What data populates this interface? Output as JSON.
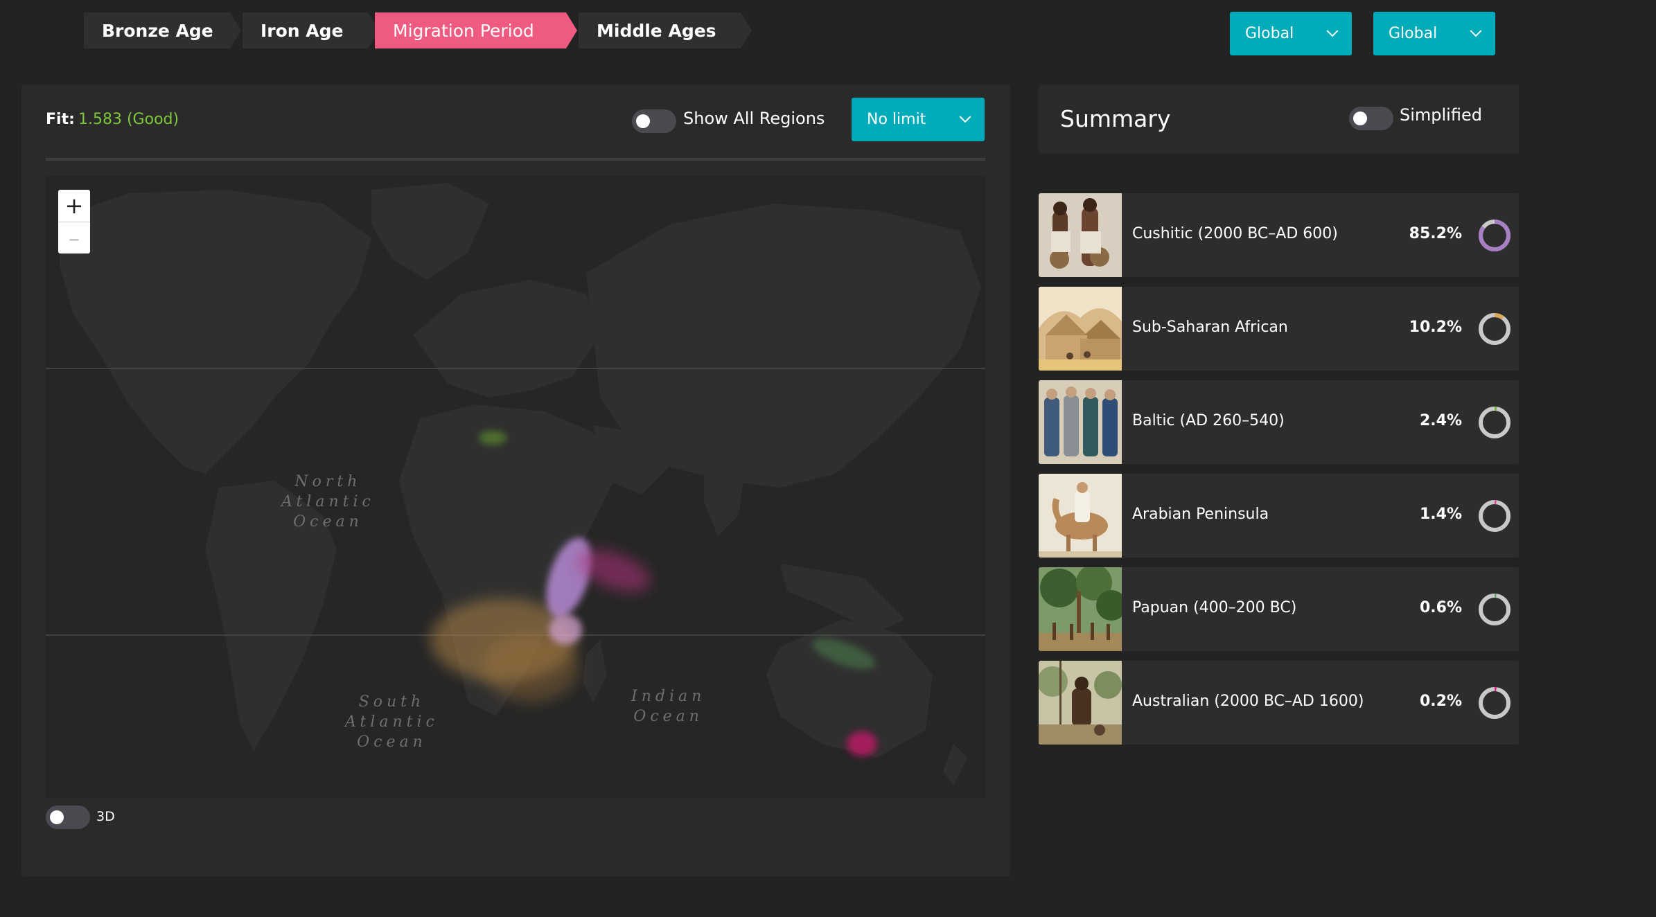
{
  "era_tabs": [
    {
      "label": "Bronze Age",
      "active": false
    },
    {
      "label": "Iron Age",
      "active": false
    },
    {
      "label": "Migration Period",
      "active": true
    },
    {
      "label": "Middle Ages",
      "active": false
    }
  ],
  "dropdowns": {
    "left": "Global",
    "right": "Global"
  },
  "map_panel": {
    "fit_label": "Fit:",
    "fit_value": "1.583 (Good)",
    "show_all_regions_label": "Show All Regions",
    "show_all_regions_on": false,
    "limit_selected": "No limit",
    "zoom_in": "+",
    "zoom_out": "–",
    "toggle_3d_label": "3D",
    "toggle_3d_on": false,
    "ocean_labels": {
      "north_atlantic": [
        "North",
        "Atlantic",
        "Ocean"
      ],
      "south_atlantic": [
        "South",
        "Atlantic",
        "Ocean"
      ],
      "indian": [
        "Indian",
        "Ocean"
      ]
    }
  },
  "summary": {
    "title": "Summary",
    "simplified_label": "Simplified",
    "simplified_on": false,
    "items": [
      {
        "label": "Cushitic (2000 BC–AD 600)",
        "percent_text": "85.2%",
        "percent": 85.2,
        "color": "#a77fc4"
      },
      {
        "label": "Sub-Saharan African",
        "percent_text": "10.2%",
        "percent": 10.2,
        "color": "#d9a85b"
      },
      {
        "label": "Baltic (AD 260–540)",
        "percent_text": "2.4%",
        "percent": 2.4,
        "color": "#7fb347"
      },
      {
        "label": "Arabian Peninsula",
        "percent_text": "1.4%",
        "percent": 1.4,
        "color": "#e0468a"
      },
      {
        "label": "Papuan (400–200 BC)",
        "percent_text": "0.6%",
        "percent": 0.6,
        "color": "#6aa86b"
      },
      {
        "label": "Australian (2000 BC–AD 1600)",
        "percent_text": "0.2%",
        "percent": 0.2,
        "color": "#e3157a"
      }
    ]
  }
}
